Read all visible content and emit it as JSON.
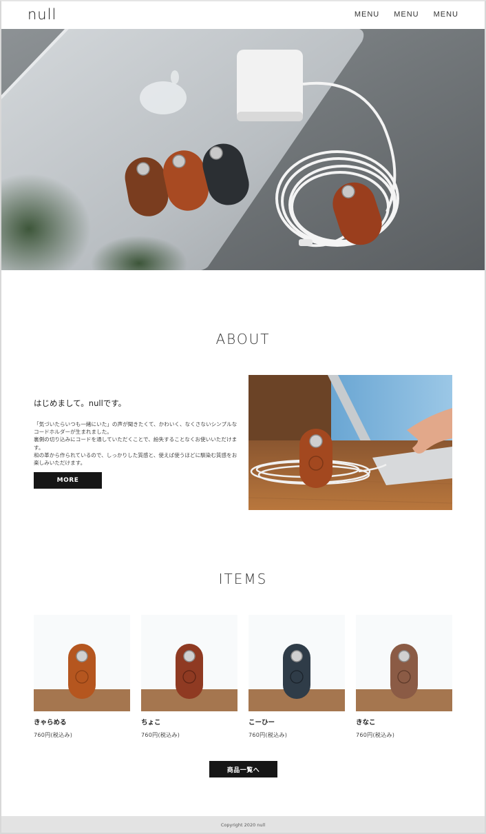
{
  "header": {
    "logo": "null",
    "nav": [
      "MENU",
      "MENU",
      "MENU"
    ]
  },
  "about": {
    "title": "ABOUT",
    "heading": "はじめまして。nullです。",
    "paragraphs": [
      "「気づいたらいつも一緒にいた」の声が聞きたくて、かわいく、なくさないシンプルなコードホルダーが生まれました。",
      "裏側の切り込みにコードを通していただくことで、紛失することなくお使いいただけます。",
      "和の革から作られているので、しっかりした質感と、使えば使うほどに馴染む質感をお楽しみいただけます。"
    ],
    "more_label": "MORE"
  },
  "items": {
    "title": "ITEMS",
    "list": [
      {
        "name": "きゃらめる",
        "price": "760円(税込み)",
        "color": "#b5561f"
      },
      {
        "name": "ちょこ",
        "price": "760円(税込み)",
        "color": "#8f3a22"
      },
      {
        "name": "こーひー",
        "price": "760円(税込み)",
        "color": "#2f3c48"
      },
      {
        "name": "きなこ",
        "price": "760円(税込み)",
        "color": "#8b5b45"
      }
    ],
    "list_button_label": "商品一覧へ"
  },
  "footer": {
    "copyright": "Copyright 2020 null"
  }
}
